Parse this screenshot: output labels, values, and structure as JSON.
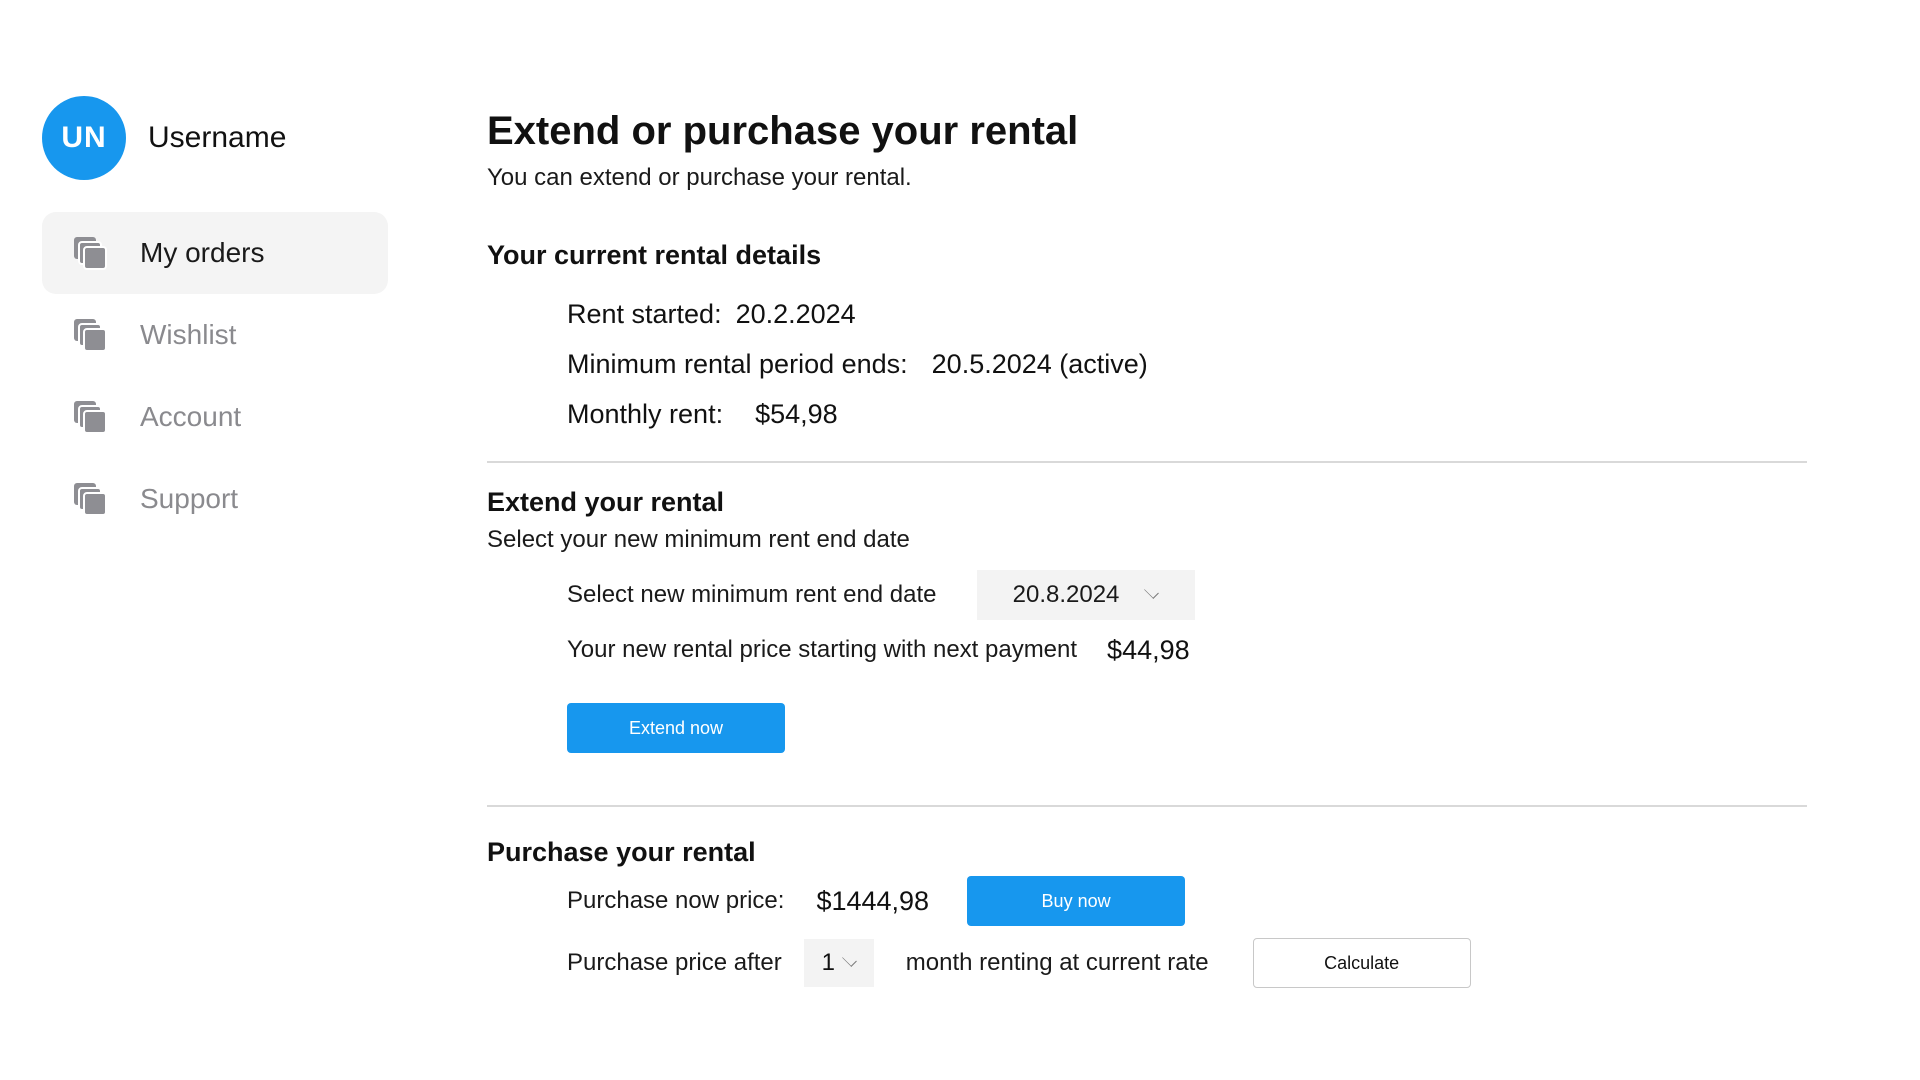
{
  "user": {
    "initials": "UN",
    "name": "Username",
    "avatar_color": "#1797ee"
  },
  "sidebar": {
    "items": [
      {
        "label": "My orders",
        "icon": "stack-icon",
        "active": true
      },
      {
        "label": "Wishlist",
        "icon": "stack-icon",
        "active": false
      },
      {
        "label": "Account",
        "icon": "stack-icon",
        "active": false
      },
      {
        "label": "Support",
        "icon": "stack-icon",
        "active": false
      }
    ]
  },
  "main": {
    "title": "Extend or purchase your rental",
    "subtitle": "You can extend or purchase your rental."
  },
  "current": {
    "heading": "Your current rental details",
    "rent_started_label": "Rent started:",
    "rent_started_value": "20.2.2024",
    "min_period_label": "Minimum rental period ends:",
    "min_period_value": "20.5.2024 (active)",
    "monthly_label": "Monthly rent:",
    "monthly_value": "$54,98"
  },
  "extend": {
    "heading": "Extend your rental",
    "subtitle": "Select your new minimum rent end date",
    "select_label": "Select new minimum rent end date",
    "selected_date": "20.8.2024",
    "new_price_label": "Your new rental price starting with next payment",
    "new_price_value": "$44,98",
    "button_label": "Extend now"
  },
  "purchase": {
    "heading": "Purchase your rental",
    "now_price_label": "Purchase now price:",
    "now_price_value": "$1444,98",
    "buy_button_label": "Buy now",
    "after_label": "Purchase price after",
    "months_value": "1",
    "after_suffix": "month renting at current rate",
    "calculate_button_label": "Calculate"
  },
  "colors": {
    "accent": "#1797ee",
    "nav_active_bg": "#f4f4f4",
    "nav_inactive_text": "#8a8a8e",
    "divider": "#d9d9d9"
  }
}
